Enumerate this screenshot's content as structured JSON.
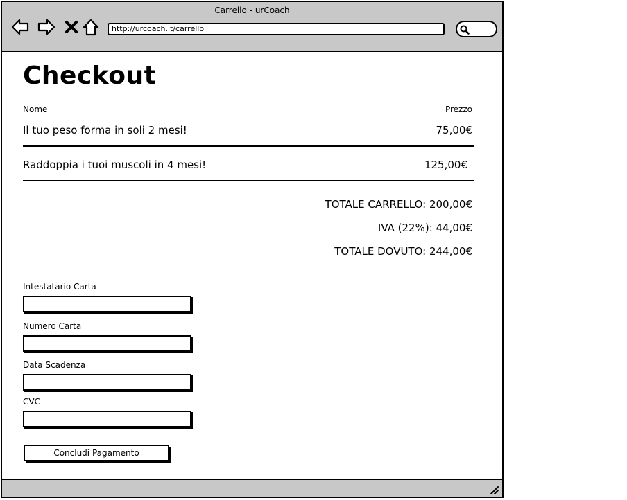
{
  "window": {
    "title": "Carrello - urCoach",
    "url": "http://urcoach.it/carrello"
  },
  "page": {
    "heading": "Checkout",
    "columns": {
      "name": "Nome",
      "price": "Prezzo"
    },
    "items": [
      {
        "name": "Il tuo peso forma in soli 2 mesi!",
        "price": "75,00€"
      },
      {
        "name": "Raddoppia i tuoi muscoli in 4 mesi!",
        "price": "125,00€"
      }
    ],
    "totals": {
      "cart": "TOTALE CARRELLO: 200,00€",
      "vat": "IVA (22%): 44,00€",
      "due": "TOTALE DOVUTO: 244,00€"
    },
    "form": {
      "holder_label": "Intestatario Carta",
      "holder_value": "",
      "number_label": "Numero Carta",
      "number_value": "",
      "expiry_label": "Data Scadenza",
      "expiry_value": "",
      "cvc_label": "CVC",
      "cvc_value": "",
      "submit_label": "Concludi Pagamento"
    }
  }
}
